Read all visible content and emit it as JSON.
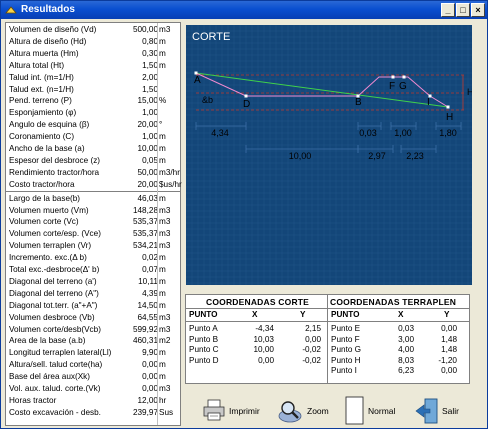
{
  "window": {
    "title": "Resultados"
  },
  "results": [
    {
      "label": "Volumen de diseño (Vd)",
      "value": "500,00",
      "unit": "m3"
    },
    {
      "label": "Altura de diseño  (Hd)",
      "value": "0,80",
      "unit": "m"
    },
    {
      "label": "Altura muerta (Hm)",
      "value": "0,30",
      "unit": "m"
    },
    {
      "label": "Altura total (Ht)",
      "value": "1,50",
      "unit": "m"
    },
    {
      "label": "Talud int. (m=1/H)",
      "value": "2,00",
      "unit": ""
    },
    {
      "label": "Talud ext. (n=1/H)",
      "value": "1,50",
      "unit": ""
    },
    {
      "label": "Pend. terreno (P)",
      "value": "15,00",
      "unit": "%"
    },
    {
      "label": "Esponjamiento (φ)",
      "value": "1,00",
      "unit": ""
    },
    {
      "label": "Angulo de esquina (β)",
      "value": "20,00",
      "unit": "°"
    },
    {
      "label": "Coronamiento (C)",
      "value": "1,00",
      "unit": "m"
    },
    {
      "label": "Ancho de la base (a)",
      "value": "10,00",
      "unit": "m"
    },
    {
      "label": "Espesor del desbroce (z)",
      "value": "0,05",
      "unit": "m"
    },
    {
      "label": "Rendimiento tractor/hora",
      "value": "50,00",
      "unit": "m3/hr"
    },
    {
      "label": "Costo tractor/hora",
      "value": "20,00",
      "unit": "$us/hr"
    },
    {
      "label": "Largo de la base(b)",
      "value": "46,03",
      "unit": "m"
    },
    {
      "label": "Volumen muerto (Vm)",
      "value": "148,28",
      "unit": "m3"
    },
    {
      "label": "Volumen corte (Vc)",
      "value": "535,37",
      "unit": "m3"
    },
    {
      "label": "Volumen corte/esp. (Vce)",
      "value": "535,37",
      "unit": "m3"
    },
    {
      "label": "Volumen terraplen (Vr)",
      "value": "534,21",
      "unit": "m3"
    },
    {
      "label": "Incremento. exc.(Δ b)",
      "value": "0,02",
      "unit": "m"
    },
    {
      "label": "Total exc.-desbroce(Δ' b)",
      "value": "0,07",
      "unit": "m"
    },
    {
      "label": "Diagonal del terreno (a')",
      "value": "10,11",
      "unit": "m"
    },
    {
      "label": "Diagonal del terreno (A\")",
      "value": "4,39",
      "unit": "m"
    },
    {
      "label": "Diagonal tot.terr. (a\"+A\")",
      "value": "14,50",
      "unit": "m"
    },
    {
      "label": "Volumen desbroce (Vb)",
      "value": "64,55",
      "unit": "m3"
    },
    {
      "label": "Volumen corte/desb(Vcb)",
      "value": "599,92",
      "unit": "m3"
    },
    {
      "label": "Area de la base (a.b)",
      "value": "460,31",
      "unit": "m2"
    },
    {
      "label": "Longitud terraplen lateral(Ll)",
      "value": "9,90",
      "unit": "m"
    },
    {
      "label": "Altura/sell. talud corte(ha)",
      "value": "0,00",
      "unit": "m"
    },
    {
      "label": "Base del área aux(Xk)",
      "value": "0,00",
      "unit": "m"
    },
    {
      "label": "Vol. aux. talud. corte.(Vk)",
      "value": "0,00",
      "unit": "m3"
    },
    {
      "label": "Horas tractor",
      "value": "12,00",
      "unit": "hr"
    },
    {
      "label": "Costo excavación - desb.",
      "value": "239,97",
      "unit": "Sus"
    }
  ],
  "plot": {
    "title": "CORTE",
    "side_label": "Ht",
    "db_label": "&b",
    "points": [
      "A",
      "D",
      "B",
      "F",
      "G",
      "I",
      "H"
    ],
    "dims": [
      "4,34",
      "0,03",
      "1,00",
      "1,80",
      "10,00",
      "2,97",
      "2,23"
    ]
  },
  "coords": {
    "corte_title": "COORDENADAS CORTE",
    "terraplen_title": "COORDENADAS TERRAPLEN",
    "col_point": "PUNTO",
    "col_x": "X",
    "col_y": "Y",
    "corte": [
      {
        "p": "Punto A",
        "x": "-4,34",
        "y": "2,15"
      },
      {
        "p": "Punto B",
        "x": "10,03",
        "y": "0,00"
      },
      {
        "p": "Punto C",
        "x": "10,00",
        "y": "-0,02"
      },
      {
        "p": "Punto D",
        "x": "0,00",
        "y": "-0,02"
      }
    ],
    "terraplen": [
      {
        "p": "Punto E",
        "x": "0,03",
        "y": "0,00"
      },
      {
        "p": "Punto F",
        "x": "3,00",
        "y": "1,48"
      },
      {
        "p": "Punto G",
        "x": "4,00",
        "y": "1,48"
      },
      {
        "p": "Punto H",
        "x": "8,03",
        "y": "-1,20"
      },
      {
        "p": "Punto I",
        "x": "6,23",
        "y": "0,00"
      }
    ]
  },
  "buttons": {
    "print": "Imprimir",
    "zoom": "Zoom",
    "normal": "Normal",
    "exit": "Salir"
  }
}
